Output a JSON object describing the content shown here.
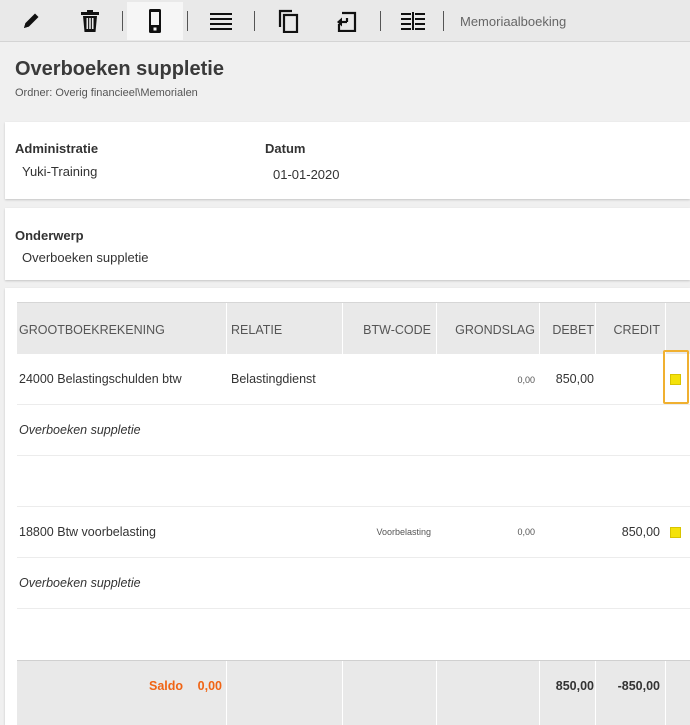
{
  "toolbar": {
    "buttons": [
      {
        "icon": "pencil-icon"
      },
      {
        "icon": "trash-icon"
      },
      {
        "icon": "mobile-icon"
      },
      {
        "icon": "list-icon"
      },
      {
        "icon": "copy-icon"
      },
      {
        "icon": "undo-icon"
      },
      {
        "icon": "columns-icon"
      }
    ],
    "label": "Memoriaalboeking"
  },
  "page": {
    "title": "Overboeken suppletie",
    "folder": "Ordner: Overig financieel\\Memorialen"
  },
  "header_card": {
    "administratie_label": "Administratie",
    "administratie_value": "Yuki-Training",
    "datum_label": "Datum",
    "datum_value": "01-01-2020"
  },
  "subject_card": {
    "label": "Onderwerp",
    "value": "Overboeken suppletie"
  },
  "table": {
    "columns": [
      "GROOTBOEKREKENING",
      "RELATIE",
      "BTW-CODE",
      "GRONDSLAG",
      "DEBET",
      "CREDIT"
    ],
    "rows": [
      {
        "account": "24000 Belastingschulden btw",
        "relation": "Belastingdienst",
        "vat_code": "",
        "basis": "0,00",
        "debit": "850,00",
        "credit": "",
        "description": "Overboeken suppletie"
      },
      {
        "account": "18800 Btw voorbelasting",
        "relation": "",
        "vat_code": "Voorbelasting",
        "basis": "0,00",
        "debit": "",
        "credit": "850,00",
        "description": "Overboeken suppletie"
      }
    ],
    "footer": {
      "saldo_label": "Saldo",
      "saldo_value": "0,00",
      "total_debit": "850,00",
      "total_credit": "-850,00"
    }
  },
  "colors": {
    "accent_orange": "#f06414",
    "marker_yellow": "#f4e20a",
    "focus_outline": "#f0b030"
  }
}
